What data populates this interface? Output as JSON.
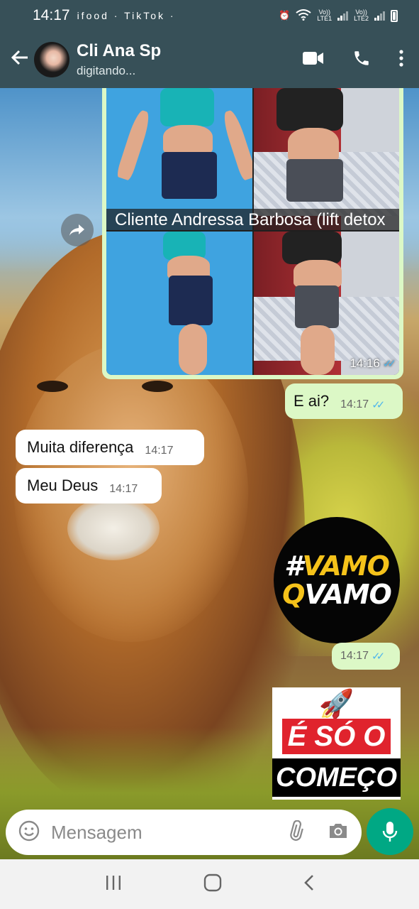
{
  "status_bar": {
    "time": "14:17",
    "notification_icons": "ifood · TikTok ·",
    "sim1": "LTE1",
    "sim2": "LTE2",
    "volte": "Vo))"
  },
  "header": {
    "contact_name": "Cli Ana Sp",
    "status": "digitando...",
    "icons": [
      "back-arrow-icon",
      "video-call-icon",
      "phone-icon",
      "more-vert-icon"
    ]
  },
  "messages": {
    "image": {
      "overlay_caption": "Cliente Andressa Barbosa (lift detox",
      "time": "14:16"
    },
    "outgoing_1": {
      "text": "E ai?",
      "time": "14:17"
    },
    "incoming_1": {
      "text": "Muita diferença",
      "time": "14:17"
    },
    "incoming_2": {
      "text": "Meu Deus",
      "time": "14:17"
    },
    "sticker_1": {
      "line1_a": "#",
      "line1_b": "VAMO",
      "line2_a": "Q",
      "line2_b": "VAMO",
      "time": "14:17"
    },
    "sticker_2": {
      "rocket": "🚀",
      "line1": "É SÓ O",
      "line2": "COMEÇO"
    }
  },
  "composer": {
    "placeholder": "Mensagem",
    "icons": [
      "emoji-icon",
      "attach-icon",
      "camera-icon",
      "mic-icon"
    ]
  },
  "colors": {
    "header": "#375058",
    "outgoing_bubble": "#dcf8c6",
    "incoming_bubble": "#ffffff",
    "accent": "#00a884",
    "read_ticks": "#4fb6ec"
  }
}
